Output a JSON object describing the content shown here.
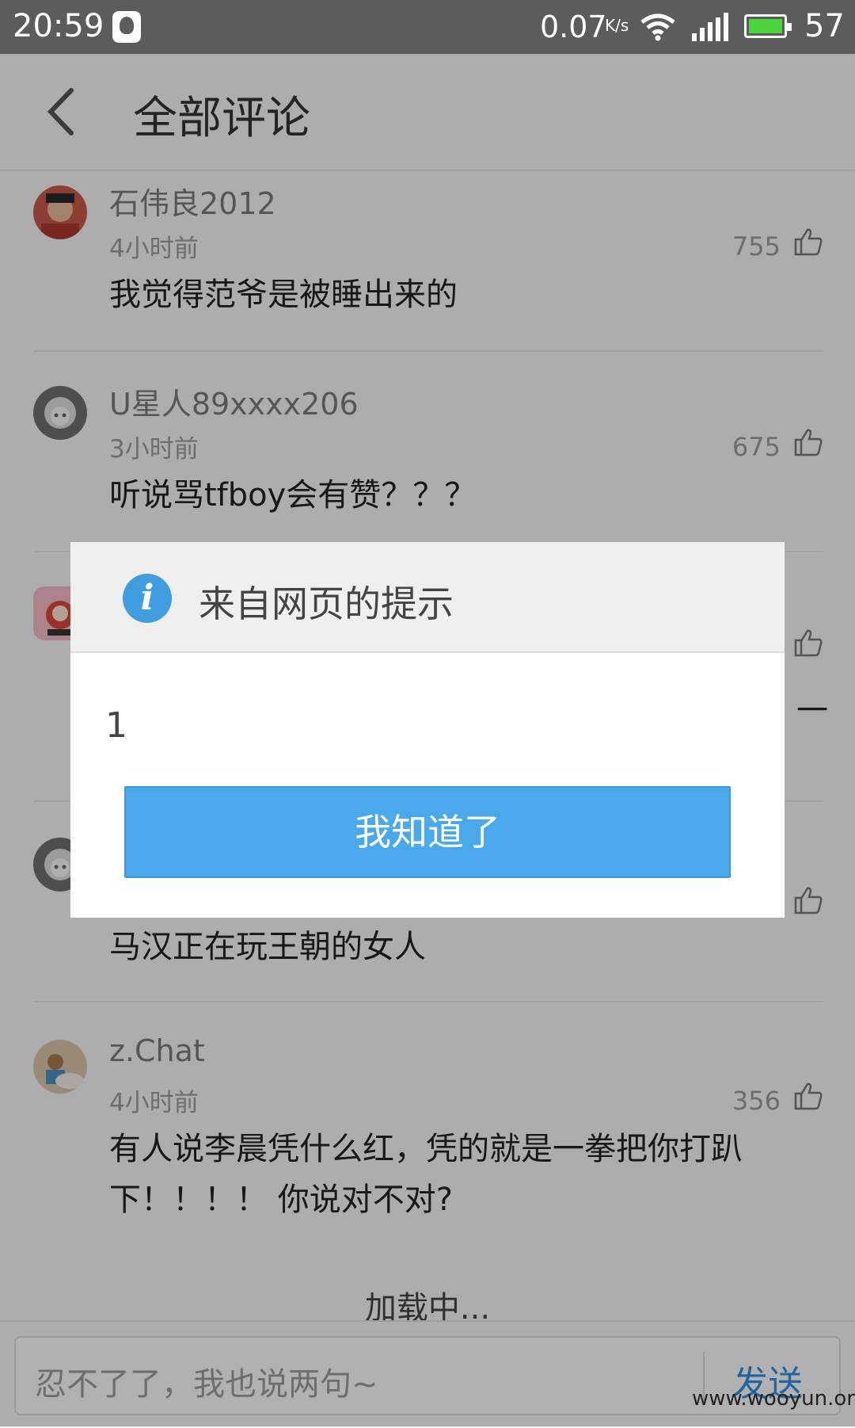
{
  "status_bar": {
    "time": "20:59",
    "speed": "0.07",
    "speed_unit": "K/s",
    "battery_level": "57",
    "battery_color": "#4cd43f"
  },
  "header": {
    "title": "全部评论"
  },
  "comments": [
    {
      "user": "石伟良2012",
      "time": "4小时前",
      "likes": "755",
      "text": "我觉得范爷是被睡出来的"
    },
    {
      "user": "U星人89xxxx206",
      "time": "3小时前",
      "likes": "675",
      "text": "听说骂tfboy会有赞？？？"
    },
    {
      "user": "",
      "time": "",
      "likes": "",
      "text": ""
    },
    {
      "user": "",
      "time": "",
      "likes": "",
      "text": "马汉正在玩王朝的女人"
    },
    {
      "user": "z.Chat",
      "time": "4小时前",
      "likes": "356",
      "text": "有人说李晨凭什么红，凭的就是一拳把你打趴下！！！！ 你说对不对?"
    }
  ],
  "partial_text_fragment": "一",
  "loading": "加载中...",
  "input_bar": {
    "placeholder": "忍不了了，我也说两句~",
    "send_label": "发送"
  },
  "watermark": "www.wooyun.org",
  "dialog": {
    "title": "来自网页的提示",
    "message": "1",
    "button_label": "我知道了",
    "info_glyph": "i"
  },
  "colors": {
    "accent": "#4aa9ea",
    "send": "#2f8ee2",
    "info": "#3f9de0"
  }
}
